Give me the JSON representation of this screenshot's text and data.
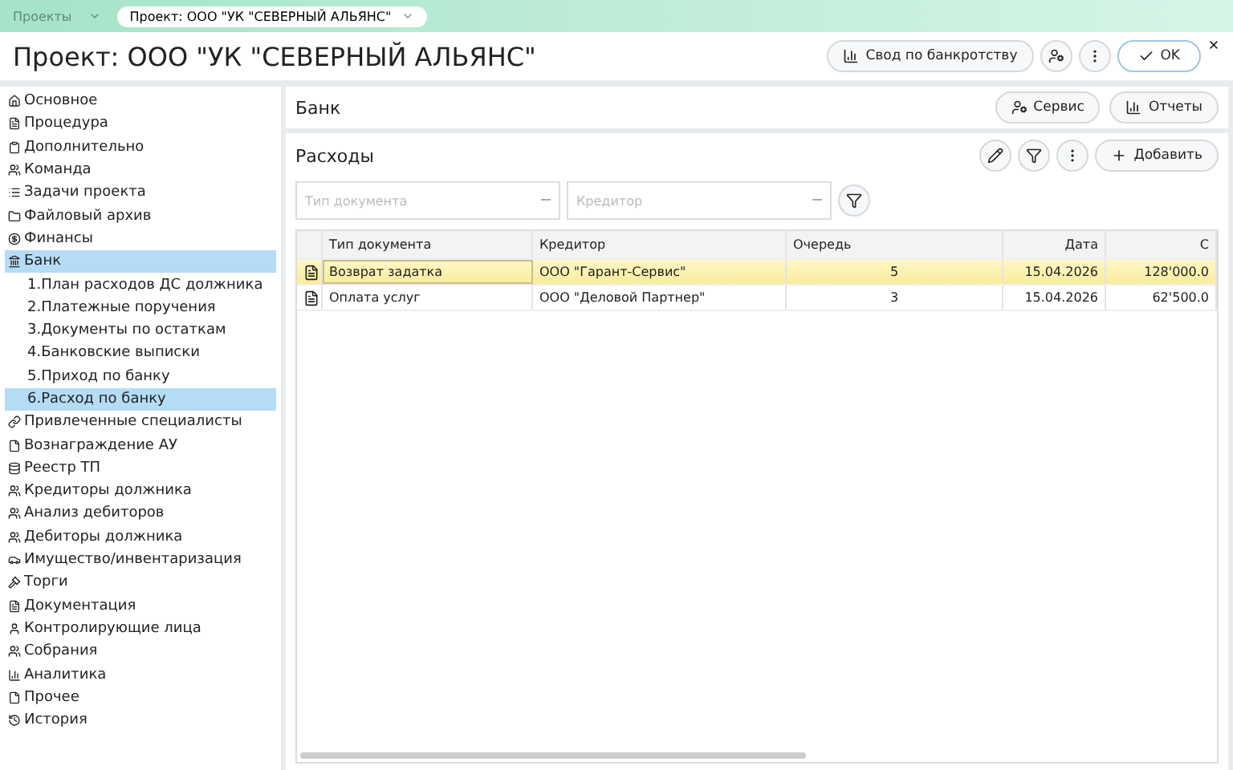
{
  "topbar": {
    "projects_label": "Проекты",
    "project_tab": "Проект: ООО \"УК \"СЕВЕРНЫЙ АЛЬЯНС\""
  },
  "header": {
    "title": "Проект: ООО \"УК \"СЕВЕРНЫЙ АЛЬЯНС\"",
    "summary_button": "Свод по банкротству",
    "ok_button": "OK"
  },
  "sidebar": {
    "items": [
      {
        "label": "Основное",
        "kind": "home",
        "selected": false
      },
      {
        "label": "Процедура",
        "kind": "doc",
        "selected": false
      },
      {
        "label": "Дополнительно",
        "kind": "clipboard",
        "selected": false
      },
      {
        "label": "Команда",
        "kind": "users",
        "selected": false
      },
      {
        "label": "Задачи проекта",
        "kind": "list",
        "selected": false
      },
      {
        "label": "Файловый архив",
        "kind": "folder",
        "selected": false
      },
      {
        "label": "Финансы",
        "kind": "finance",
        "selected": false
      },
      {
        "label": "Банк",
        "kind": "bank",
        "selected": true,
        "children": [
          {
            "label": "1.План расходов ДС должника",
            "selected": false
          },
          {
            "label": "2.Платежные поручения",
            "selected": false
          },
          {
            "label": "3.Документы по остаткам",
            "selected": false
          },
          {
            "label": "4.Банковские выписки",
            "selected": false
          },
          {
            "label": "5.Приход по банку",
            "selected": false
          },
          {
            "label": "6.Расход по банку",
            "selected": true
          }
        ]
      },
      {
        "label": "Привлеченные специалисты",
        "kind": "link",
        "selected": false
      },
      {
        "label": "Вознаграждение АУ",
        "kind": "file",
        "selected": false
      },
      {
        "label": "Реестр ТП",
        "kind": "database",
        "selected": false
      },
      {
        "label": "Кредиторы должника",
        "kind": "users",
        "selected": false
      },
      {
        "label": "Анализ дебиторов",
        "kind": "users",
        "selected": false
      },
      {
        "label": "Дебиторы должника",
        "kind": "users",
        "selected": false
      },
      {
        "label": "Имущество/инвентаризация",
        "kind": "car",
        "selected": false
      },
      {
        "label": "Торги",
        "kind": "gavel",
        "selected": false
      },
      {
        "label": "Документация",
        "kind": "doc",
        "selected": false
      },
      {
        "label": "Контролирующие лица",
        "kind": "user",
        "selected": false
      },
      {
        "label": "Собрания",
        "kind": "users",
        "selected": false
      },
      {
        "label": "Аналитика",
        "kind": "chart",
        "selected": false
      },
      {
        "label": "Прочее",
        "kind": "file",
        "selected": false
      },
      {
        "label": "История",
        "kind": "history",
        "selected": false
      }
    ]
  },
  "section": {
    "title": "Банк",
    "service_button": "Сервис",
    "reports_button": "Отчеты"
  },
  "expenses": {
    "title": "Расходы",
    "add_button": "Добавить",
    "filters": [
      {
        "placeholder": "Тип документа"
      },
      {
        "placeholder": "Кредитор"
      }
    ],
    "columns": [
      "Тип документа",
      "Кредитор",
      "Очередь",
      "Дата",
      "С"
    ],
    "rows": [
      {
        "selected": true,
        "cells": [
          "Возврат задатка",
          "ООО \"Гарант-Сервис\"",
          "5",
          "15.04.2026",
          "128'000.0"
        ]
      },
      {
        "selected": false,
        "cells": [
          "Оплата услуг",
          "ООО \"Деловой Партнер\"",
          "3",
          "15.04.2026",
          "62'500.0"
        ]
      }
    ]
  }
}
